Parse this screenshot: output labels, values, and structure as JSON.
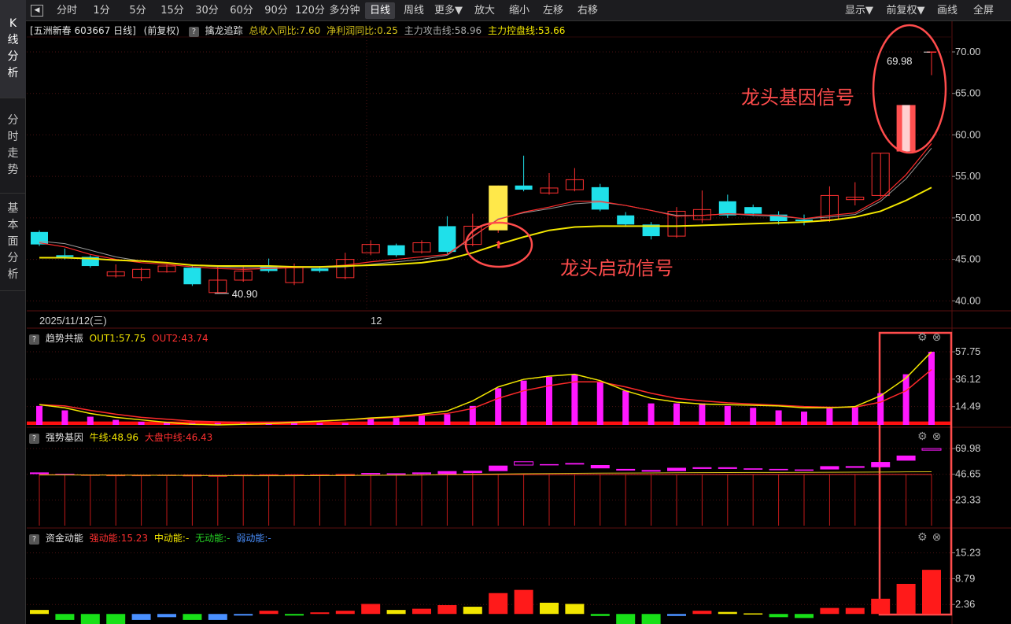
{
  "left_tabs": [
    {
      "chars": [
        "K",
        "线",
        "分",
        "析"
      ],
      "active": true
    },
    {
      "chars": [
        "分",
        "时",
        "走",
        "势"
      ],
      "active": false
    },
    {
      "chars": [
        "基",
        "本",
        "面",
        "分",
        "析"
      ],
      "active": false
    }
  ],
  "toolbar": {
    "buttons": [
      "分时",
      "1分",
      "5分",
      "15分",
      "30分",
      "60分",
      "90分",
      "120分",
      "多分钟",
      "日线",
      "周线",
      "更多▼",
      "放大",
      "缩小",
      "左移",
      "右移"
    ],
    "active": "日线",
    "right_buttons": [
      "显示▼",
      "前复权▼",
      "画线",
      "全屏"
    ]
  },
  "main_info": {
    "stock": "[五洲新春 603667 日线]",
    "adjust": "(前复权)",
    "indicator_name": "擒龙追踪",
    "rev_growth": "总收入同比:7.60",
    "profit_growth": "净利润同比:0.25",
    "attack_line": "主力攻击线:58.96",
    "control_line": "主力控盘线:53.66"
  },
  "panel2_info": {
    "name": "趋势共振",
    "out1": "OUT1:57.75",
    "out2": "OUT2:43.74"
  },
  "panel3_info": {
    "name": "强势基因",
    "bull": "牛线:48.96",
    "mid": "大盘中线:46.43"
  },
  "panel4_info": {
    "name": "资金动能",
    "strong": "强动能:15.23",
    "medium": "中动能:-",
    "none": "无动能:-",
    "weak": "弱动能:-"
  },
  "annotations": {
    "gene_signal": "龙头基因信号",
    "start_signal": "龙头启动信号",
    "high_label": "69.98",
    "low_label": "40.90"
  },
  "date_axis": {
    "start": "2025/11/12(三)",
    "month": "12"
  },
  "colors": {
    "up": "#ff3030",
    "down": "#1fe0ea",
    "ma_yellow": "#f2e600",
    "magenta": "#ff18ff",
    "annotation": "#ff4c4c"
  },
  "chart_data": [
    {
      "type": "candlestick",
      "title": "",
      "y_ticks": [
        "70.00",
        "65.00",
        "60.00",
        "55.00",
        "50.00",
        "45.00",
        "40.00"
      ],
      "ylim": [
        38.8,
        71.8
      ],
      "candles": [
        {
          "o": 48.3,
          "c": 46.8,
          "h": 48.5,
          "l": 46.6
        },
        {
          "o": 45.5,
          "c": 45.3,
          "h": 46.3,
          "l": 45.0
        },
        {
          "o": 45.3,
          "c": 44.2,
          "h": 45.5,
          "l": 44.0
        },
        {
          "o": 43.0,
          "c": 43.5,
          "h": 44.4,
          "l": 42.8
        },
        {
          "o": 42.8,
          "c": 43.8,
          "h": 44.0,
          "l": 42.4
        },
        {
          "o": 43.5,
          "c": 44.2,
          "h": 44.4,
          "l": 43.4
        },
        {
          "o": 44.0,
          "c": 42.0,
          "h": 44.4,
          "l": 41.8
        },
        {
          "o": 41.0,
          "c": 42.5,
          "h": 44.3,
          "l": 40.9
        },
        {
          "o": 42.5,
          "c": 43.6,
          "h": 44.2,
          "l": 42.3
        },
        {
          "o": 44.2,
          "c": 43.6,
          "h": 45.1,
          "l": 43.4
        },
        {
          "o": 42.2,
          "c": 44.0,
          "h": 44.5,
          "l": 41.9
        },
        {
          "o": 43.9,
          "c": 43.6,
          "h": 44.2,
          "l": 43.4
        },
        {
          "o": 42.8,
          "c": 45.0,
          "h": 45.8,
          "l": 42.6
        },
        {
          "o": 45.8,
          "c": 46.8,
          "h": 47.3,
          "l": 45.5
        },
        {
          "o": 46.7,
          "c": 45.5,
          "h": 46.9,
          "l": 45.3
        },
        {
          "o": 45.9,
          "c": 47.0,
          "h": 47.3,
          "l": 45.7
        },
        {
          "o": 49.0,
          "c": 45.9,
          "h": 50.2,
          "l": 45.6
        },
        {
          "o": 46.8,
          "c": 49.0,
          "h": 50.5,
          "l": 46.6
        },
        {
          "o": 48.5,
          "c": 53.9,
          "h": 53.9,
          "l": 48.2
        },
        {
          "o": 53.9,
          "c": 53.4,
          "h": 57.5,
          "l": 53.2
        },
        {
          "o": 53.0,
          "c": 53.6,
          "h": 55.4,
          "l": 52.8
        },
        {
          "o": 53.4,
          "c": 54.6,
          "h": 56.0,
          "l": 53.2
        },
        {
          "o": 53.7,
          "c": 51.0,
          "h": 54.1,
          "l": 50.8
        },
        {
          "o": 50.3,
          "c": 49.2,
          "h": 50.7,
          "l": 48.9
        },
        {
          "o": 49.2,
          "c": 47.8,
          "h": 49.5,
          "l": 47.4
        },
        {
          "o": 47.8,
          "c": 50.8,
          "h": 51.3,
          "l": 47.6
        },
        {
          "o": 49.8,
          "c": 51.0,
          "h": 53.3,
          "l": 49.4
        },
        {
          "o": 52.0,
          "c": 50.3,
          "h": 52.8,
          "l": 50.0
        },
        {
          "o": 51.3,
          "c": 50.5,
          "h": 51.6,
          "l": 50.2
        },
        {
          "o": 50.4,
          "c": 49.6,
          "h": 50.8,
          "l": 49.2
        },
        {
          "o": 49.8,
          "c": 49.6,
          "h": 50.4,
          "l": 49.1
        },
        {
          "o": 49.8,
          "c": 52.7,
          "h": 53.8,
          "l": 49.5
        },
        {
          "o": 52.2,
          "c": 52.5,
          "h": 54.3,
          "l": 51.5
        },
        {
          "o": 52.7,
          "c": 57.8,
          "h": 57.8,
          "l": 52.5
        },
        {
          "o": 58.0,
          "c": 63.6,
          "h": 63.6,
          "l": 57.8
        },
        {
          "o": 69.98,
          "c": 69.98,
          "h": 69.98,
          "l": 67.2
        }
      ],
      "ma_yellow": [
        45.2,
        45.2,
        45.1,
        44.9,
        44.8,
        44.6,
        44.3,
        44.2,
        44.2,
        44.2,
        44.1,
        44.1,
        44.2,
        44.3,
        44.4,
        44.6,
        45.0,
        45.8,
        46.8,
        47.7,
        48.5,
        48.9,
        49.0,
        49.0,
        49.0,
        49.0,
        49.1,
        49.2,
        49.3,
        49.4,
        49.5,
        49.7,
        50.1,
        50.8,
        52.1,
        53.66
      ],
      "ma_red": [
        47.0,
        46.5,
        45.6,
        45.0,
        44.6,
        44.4,
        44.1,
        43.9,
        43.8,
        43.9,
        44.0,
        44.1,
        44.3,
        44.7,
        45.0,
        45.3,
        45.6,
        47.8,
        49.8,
        50.7,
        51.3,
        52.0,
        52.0,
        51.5,
        50.9,
        50.2,
        50.3,
        50.5,
        50.4,
        50.3,
        49.9,
        50.3,
        50.6,
        52.3,
        55.2,
        58.96
      ],
      "ma_gray": [
        47.2,
        46.9,
        46.1,
        45.3,
        44.8,
        44.6,
        44.3,
        44.1,
        44.0,
        44.0,
        44.0,
        44.0,
        44.1,
        44.4,
        44.7,
        45.0,
        45.5,
        47.7,
        49.9,
        50.6,
        51.1,
        51.7,
        51.9,
        51.5,
        50.9,
        50.3,
        50.3,
        50.5,
        50.3,
        50.2,
        49.9,
        50.1,
        50.4,
        52.0,
        54.7,
        58.4
      ]
    },
    {
      "type": "bar",
      "title": "",
      "y_ticks": [
        "57.75",
        "36.12",
        "14.49"
      ],
      "ylim": [
        0,
        64
      ],
      "bars": [
        15.0,
        11.5,
        6.5,
        4.0,
        2.5,
        2.0,
        1.5,
        1.5,
        1.5,
        1.5,
        1.5,
        1.5,
        1.5,
        5.5,
        5.5,
        7.5,
        8.5,
        15.0,
        29.0,
        35.0,
        38.0,
        40.0,
        34.0,
        27.0,
        17.0,
        17.0,
        17.0,
        15.0,
        13.5,
        11.5,
        10.5,
        13.0,
        14.0,
        25.0,
        40.0,
        57.75
      ],
      "out1": [
        16.0,
        13.5,
        9.0,
        6.0,
        4.0,
        2.0,
        0.5,
        0.0,
        0.5,
        1.0,
        2.0,
        3.0,
        4.0,
        5.5,
        6.5,
        8.5,
        11.0,
        19.0,
        30.0,
        36.0,
        38.5,
        40.0,
        35.0,
        27.0,
        21.0,
        18.0,
        16.5,
        16.0,
        15.5,
        15.0,
        13.5,
        13.5,
        14.5,
        23.0,
        37.0,
        57.75
      ],
      "out2": [
        16.0,
        15.0,
        11.5,
        8.5,
        6.0,
        4.5,
        3.0,
        2.5,
        2.0,
        2.0,
        2.5,
        3.0,
        4.0,
        5.0,
        6.0,
        7.5,
        9.0,
        13.0,
        21.0,
        27.0,
        31.0,
        34.0,
        34.0,
        30.0,
        25.0,
        21.0,
        19.0,
        17.5,
        16.5,
        15.5,
        14.5,
        14.0,
        14.0,
        18.0,
        27.0,
        43.74
      ],
      "threshold": 2.0
    },
    {
      "type": "bar",
      "title": "",
      "y_ticks": [
        "69.98",
        "46.65",
        "23.33"
      ],
      "ylim": [
        0,
        75
      ],
      "boxes": [
        {
          "top": 48.3,
          "bot": 46.8,
          "fill": "#ff18ff"
        },
        {
          "top": 47.0,
          "bot": 46.3,
          "fill": "#ff18ff"
        },
        {
          "top": 46.3,
          "bot": 45.5,
          "fill": "#ff3030"
        },
        {
          "top": 46.0,
          "bot": 45.5,
          "fill": "#ff3030"
        },
        {
          "top": 46.0,
          "bot": 45.0,
          "fill": "#ff3030"
        },
        {
          "top": 46.2,
          "bot": 45.2,
          "fill": "#ff3030"
        },
        {
          "top": 46.3,
          "bot": 44.8,
          "fill": "#ff3030"
        },
        {
          "top": 46.0,
          "bot": 44.5,
          "fill": "#ff3030"
        },
        {
          "top": 46.3,
          "bot": 45.0,
          "fill": "#ff3030"
        },
        {
          "top": 46.5,
          "bot": 45.3,
          "fill": "#ff3030"
        },
        {
          "top": 46.5,
          "bot": 45.0,
          "fill": "#ff3030"
        },
        {
          "top": 46.5,
          "bot": 45.5,
          "fill": "#ff3030"
        },
        {
          "top": 46.8,
          "bot": 45.0,
          "fill": "#ff3030"
        },
        {
          "top": 47.8,
          "bot": 46.5,
          "fill": "#ff18ff"
        },
        {
          "top": 47.5,
          "bot": 46.3,
          "fill": "#ff18ff"
        },
        {
          "top": 48.3,
          "bot": 46.8,
          "fill": "#ff18ff"
        },
        {
          "top": 49.5,
          "bot": 46.8,
          "fill": "#ff18ff"
        },
        {
          "top": 49.8,
          "bot": 47.8,
          "fill": "#ff18ff"
        },
        {
          "top": 54.5,
          "bot": 49.5,
          "fill": "#ff18ff"
        },
        {
          "top": 58.0,
          "bot": 55.0,
          "fill": "none"
        },
        {
          "top": 55.8,
          "bot": 54.8,
          "fill": "#ff18ff"
        },
        {
          "top": 56.8,
          "bot": 55.5,
          "fill": "#ff18ff"
        },
        {
          "top": 55.0,
          "bot": 52.0,
          "fill": "#ff18ff"
        },
        {
          "top": 51.5,
          "bot": 50.0,
          "fill": "#ff18ff"
        },
        {
          "top": 50.5,
          "bot": 49.0,
          "fill": "#ff18ff"
        },
        {
          "top": 52.5,
          "bot": 49.5,
          "fill": "#ff18ff"
        },
        {
          "top": 53.0,
          "bot": 51.5,
          "fill": "#ff18ff"
        },
        {
          "top": 53.0,
          "bot": 51.5,
          "fill": "#ff18ff"
        },
        {
          "top": 52.0,
          "bot": 50.8,
          "fill": "#ff18ff"
        },
        {
          "top": 51.5,
          "bot": 50.3,
          "fill": "#ff18ff"
        },
        {
          "top": 51.0,
          "bot": 49.8,
          "fill": "#ff18ff"
        },
        {
          "top": 54.0,
          "bot": 51.0,
          "fill": "#ff18ff"
        },
        {
          "top": 54.0,
          "bot": 52.5,
          "fill": "#ff18ff"
        },
        {
          "top": 57.8,
          "bot": 53.0,
          "fill": "#ff18ff"
        },
        {
          "top": 63.6,
          "bot": 59.0,
          "fill": "#ff18ff"
        },
        {
          "top": 70.0,
          "bot": 68.5,
          "fill": "none"
        }
      ],
      "stems": [
        46.8,
        46.3,
        45.5,
        45.5,
        45.0,
        45.2,
        44.8,
        44.5,
        45.0,
        45.3,
        45.0,
        45.5,
        45.0,
        46.5,
        46.3,
        46.8,
        46.8,
        47.8,
        46.8,
        46.8,
        46.8,
        46.8,
        46.8,
        46.8,
        46.8,
        46.8,
        46.8,
        46.8,
        46.8,
        46.8,
        46.8,
        46.8,
        46.8,
        46.8,
        46.8,
        46.8
      ],
      "bull_line": [
        46.0,
        46.0,
        45.9,
        45.8,
        45.7,
        45.6,
        45.5,
        45.4,
        45.3,
        45.3,
        45.3,
        45.4,
        45.5,
        45.6,
        45.8,
        46.0,
        46.3,
        46.6,
        46.9,
        47.1,
        47.3,
        47.5,
        47.7,
        47.8,
        47.9,
        48.0,
        48.1,
        48.2,
        48.3,
        48.3,
        48.4,
        48.5,
        48.6,
        48.7,
        48.8,
        48.96
      ],
      "mid_line": [
        46.3,
        46.2,
        46.1,
        46.0,
        45.9,
        45.8,
        45.7,
        45.6,
        45.6,
        45.6,
        45.6,
        45.6,
        45.7,
        45.8,
        45.9,
        46.0,
        46.1,
        46.2,
        46.3,
        46.3,
        46.3,
        46.3,
        46.3,
        46.3,
        46.3,
        46.3,
        46.4,
        46.4,
        46.4,
        46.4,
        46.4,
        46.4,
        46.4,
        46.4,
        46.4,
        46.43
      ]
    },
    {
      "type": "bar",
      "title": "",
      "y_ticks": [
        "15.23",
        "8.79",
        "2.36"
      ],
      "ylim": [
        -2.5,
        17.5
      ],
      "values": [
        1.0,
        -1.5,
        -2.5,
        -2.5,
        -1.5,
        -0.8,
        -1.5,
        -1.5,
        -0.4,
        0.8,
        -0.4,
        0.4,
        0.8,
        2.5,
        1.0,
        1.3,
        2.2,
        1.8,
        5.2,
        6.0,
        2.8,
        2.5,
        -0.5,
        -2.5,
        -2.5,
        -0.5,
        0.8,
        0.5,
        0.15,
        -0.8,
        -1.0,
        1.5,
        1.5,
        3.8,
        7.5,
        11.0
      ],
      "colors": [
        "#f2e600",
        "#18e018",
        "#18e018",
        "#18e018",
        "#4a90ff",
        "#4a90ff",
        "#18e018",
        "#4a90ff",
        "#4a90ff",
        "#ff1a1a",
        "#18e018",
        "#ff1a1a",
        "#ff1a1a",
        "#ff1a1a",
        "#f2e600",
        "#ff1a1a",
        "#ff1a1a",
        "#f2e600",
        "#ff1a1a",
        "#ff1a1a",
        "#f2e600",
        "#f2e600",
        "#18e018",
        "#18e018",
        "#18e018",
        "#4a90ff",
        "#ff1a1a",
        "#f2e600",
        "#f2e600",
        "#18e018",
        "#18e018",
        "#ff1a1a",
        "#ff1a1a",
        "#ff1a1a",
        "#ff1a1a",
        "#ff1a1a"
      ]
    }
  ]
}
